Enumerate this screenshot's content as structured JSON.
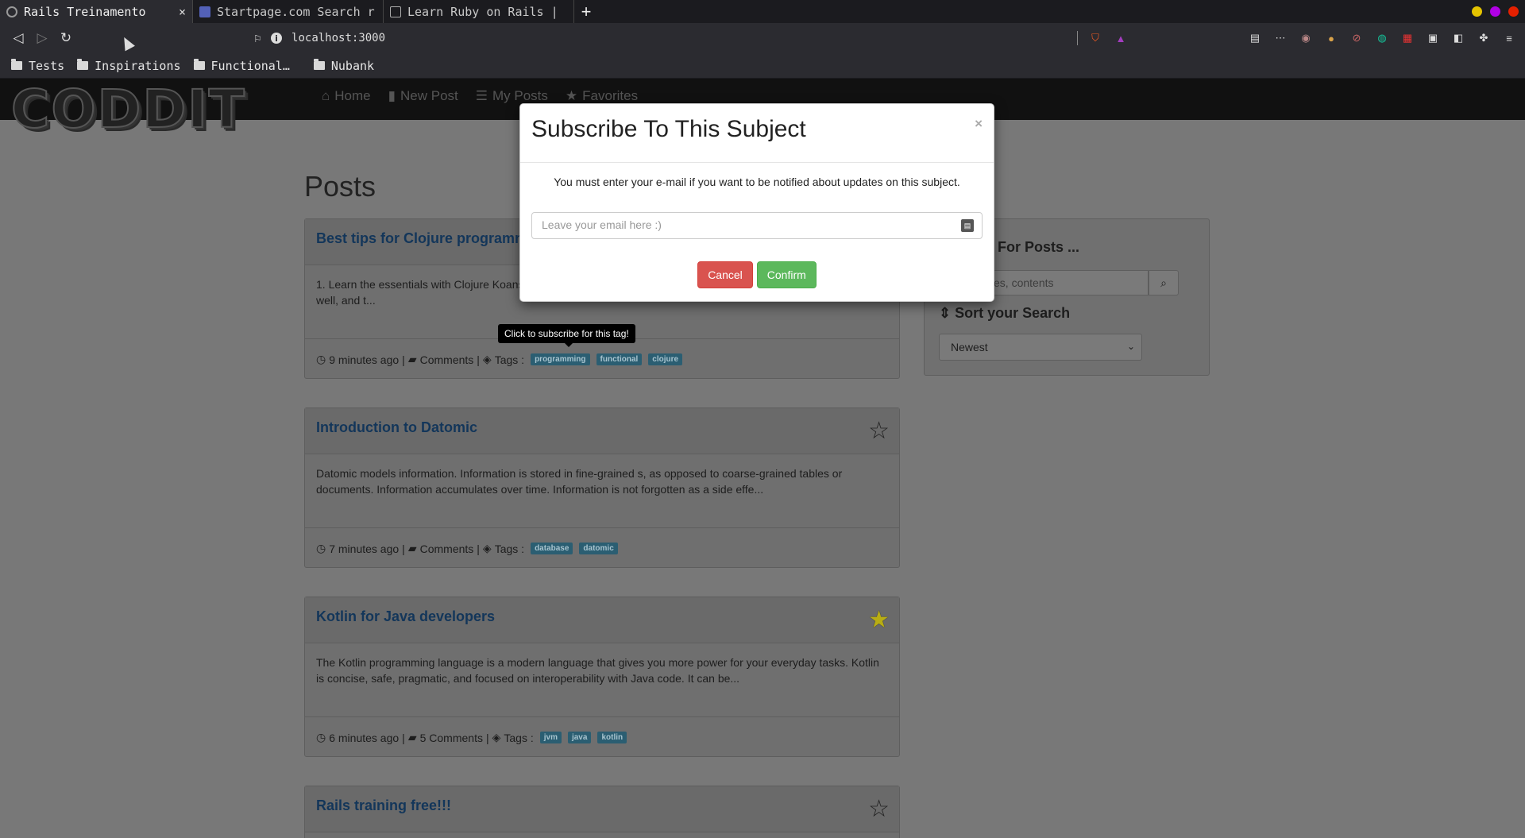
{
  "browser": {
    "tabs": [
      {
        "title": "Rails Treinamento",
        "close": "×"
      },
      {
        "title": "Startpage.com Search r"
      },
      {
        "title": "Learn Ruby on Rails  |"
      }
    ],
    "new_tab": "+",
    "address": "localhost:3000",
    "bookmarks": [
      "Tests",
      "Inspirations",
      "Functional…",
      "Nubank"
    ],
    "window_colors": [
      "#e5c400",
      "#b200e5",
      "#e52000"
    ]
  },
  "site": {
    "logo": "CODDIT",
    "nav": [
      {
        "icon": "home-icon",
        "label": "Home"
      },
      {
        "icon": "book-icon",
        "label": "New Post"
      },
      {
        "icon": "list-icon",
        "label": "My Posts"
      },
      {
        "icon": "star-icon",
        "label": "Favorites"
      }
    ]
  },
  "main": {
    "title": "Posts",
    "posts": [
      {
        "title": "Best tips for Clojure programm",
        "body": "1. Learn the essentials with Clojure Koans... series of tests for you to turn green. The topics and tests are chosen well, and t...",
        "time": "9 minutes ago",
        "comments": "Comments",
        "tags_label": "Tags :",
        "tags": [
          "programming",
          "functional",
          "clojure"
        ],
        "favorite": false
      },
      {
        "title": "Introduction to Datomic",
        "body": "Datomic models information. Information is stored in fine-grained s, as opposed to coarse-grained tables or documents. Information accumulates over time. Information is not forgotten as a side effe...",
        "time": "7 minutes ago",
        "comments": "Comments",
        "tags_label": "Tags :",
        "tags": [
          "database",
          "datomic"
        ],
        "favorite": false
      },
      {
        "title": "Kotlin for Java developers",
        "body": "The Kotlin programming language is a modern language that gives you more power for your everyday tasks. Kotlin is concise, safe, pragmatic, and focused on interoperability with Java code. It can be...",
        "time": "6 minutes ago",
        "comments": "5 Comments",
        "tags_label": "Tags :",
        "tags": [
          "jvm",
          "java",
          "kotlin"
        ],
        "favorite": true
      },
      {
        "title": "Rails training free!!!",
        "favorite": false
      }
    ],
    "tooltip": "Click to subscribe for this tag!"
  },
  "sidebar": {
    "search_title": "h For Posts ...",
    "search_placeholder": "es, contents",
    "sort_title": "Sort your Search",
    "sort_value": "Newest"
  },
  "modal": {
    "title": "Subscribe To This Subject",
    "close": "×",
    "message": "You must enter your e-mail if you want to be notified about updates on this subject.",
    "email_placeholder": "Leave your email here :)",
    "cancel": "Cancel",
    "confirm": "Confirm"
  }
}
